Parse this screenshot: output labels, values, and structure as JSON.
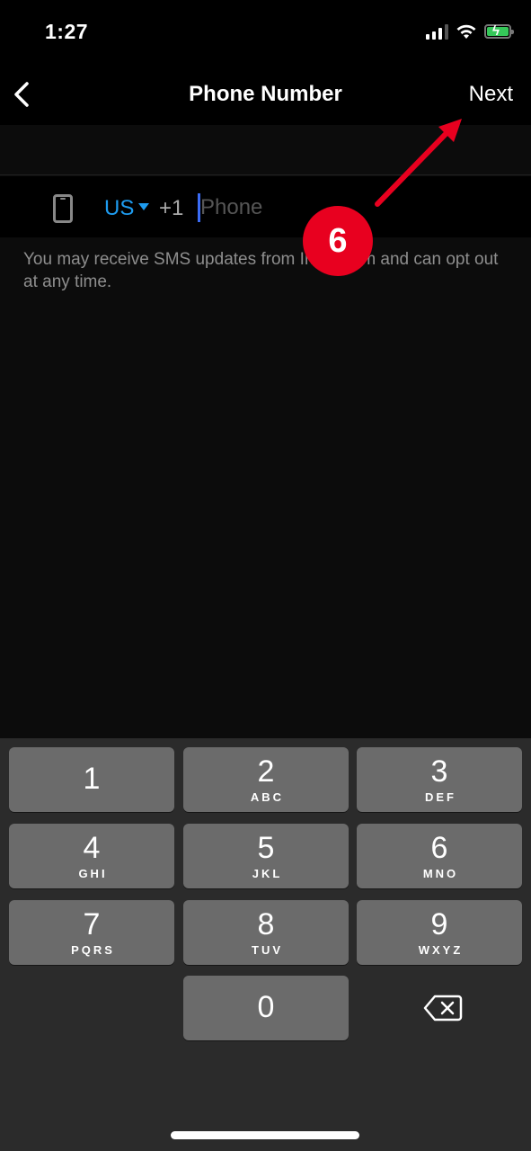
{
  "status_bar": {
    "time": "1:27",
    "icons": [
      "cellular-signal-icon",
      "wifi-icon",
      "battery-charging-icon"
    ],
    "battery_color": "#35c759"
  },
  "nav": {
    "back_icon": "chevron-left-icon",
    "title": "Phone Number",
    "next_label": "Next"
  },
  "phone_field": {
    "device_icon": "smartphone-icon",
    "country": "US",
    "country_dropdown_icon": "caret-down-icon",
    "dial_code": "+1",
    "value": "",
    "placeholder": "Phone",
    "accent_color": "#1e9cf0"
  },
  "note": "You may receive SMS updates from Instagram and can opt out at any time.",
  "keyboard": {
    "keys": [
      {
        "digit": "1",
        "letters": ""
      },
      {
        "digit": "2",
        "letters": "ABC"
      },
      {
        "digit": "3",
        "letters": "DEF"
      },
      {
        "digit": "4",
        "letters": "GHI"
      },
      {
        "digit": "5",
        "letters": "JKL"
      },
      {
        "digit": "6",
        "letters": "MNO"
      },
      {
        "digit": "7",
        "letters": "PQRS"
      },
      {
        "digit": "8",
        "letters": "TUV"
      },
      {
        "digit": "9",
        "letters": "WXYZ"
      },
      {
        "digit": "0",
        "letters": ""
      }
    ],
    "delete_icon": "backspace-icon"
  },
  "annotation": {
    "step_number": "6",
    "color": "#e8001f",
    "points_to": "Next"
  }
}
